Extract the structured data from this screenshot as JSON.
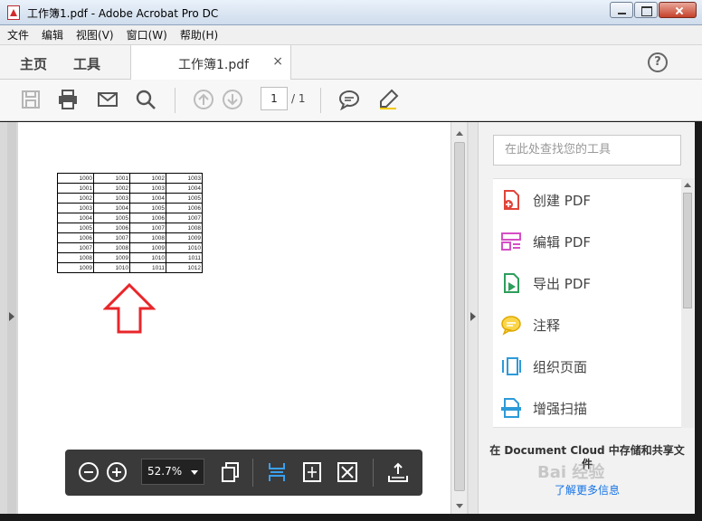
{
  "window": {
    "title": "工作簿1.pdf - Adobe Acrobat Pro DC"
  },
  "menu": [
    "文件",
    "编辑",
    "视图(V)",
    "窗口(W)",
    "帮助(H)"
  ],
  "nav": {
    "home": "主页",
    "tools": "工具"
  },
  "doc_tab": {
    "title": "工作簿1.pdf",
    "close": "×"
  },
  "help": "?",
  "toolbar": {
    "page_current": "1",
    "page_total": "/ 1"
  },
  "sheet": {
    "rows": [
      [
        "1000",
        "1001",
        "1002",
        "1003"
      ],
      [
        "1001",
        "1002",
        "1003",
        "1004"
      ],
      [
        "1002",
        "1003",
        "1004",
        "1005"
      ],
      [
        "1003",
        "1004",
        "1005",
        "1006"
      ],
      [
        "1004",
        "1005",
        "1006",
        "1007"
      ],
      [
        "1005",
        "1006",
        "1007",
        "1008"
      ],
      [
        "1006",
        "1007",
        "1008",
        "1009"
      ],
      [
        "1007",
        "1008",
        "1009",
        "1010"
      ],
      [
        "1008",
        "1009",
        "1010",
        "1011"
      ],
      [
        "1009",
        "1010",
        "1011",
        "1012"
      ]
    ]
  },
  "zoom": {
    "value": "52.7%"
  },
  "right_pane": {
    "search_placeholder": "在此处查找您的工具",
    "tools": [
      {
        "label": "创建 PDF",
        "icon": "create-pdf-icon",
        "color": "#e0443a"
      },
      {
        "label": "编辑 PDF",
        "icon": "edit-pdf-icon",
        "color": "#d64fc6"
      },
      {
        "label": "导出 PDF",
        "icon": "export-pdf-icon",
        "color": "#2e9e5b"
      },
      {
        "label": "注释",
        "icon": "comment-icon",
        "color": "#f0b400"
      },
      {
        "label": "组织页面",
        "icon": "organize-pages-icon",
        "color": "#2d9ad8"
      },
      {
        "label": "增强扫描",
        "icon": "enhance-scan-icon",
        "color": "#2d9ad8"
      }
    ],
    "promo": "在 Document Cloud 中存储和共享文件",
    "learn_more": "了解更多信息"
  },
  "watermark": "Bai 经验"
}
